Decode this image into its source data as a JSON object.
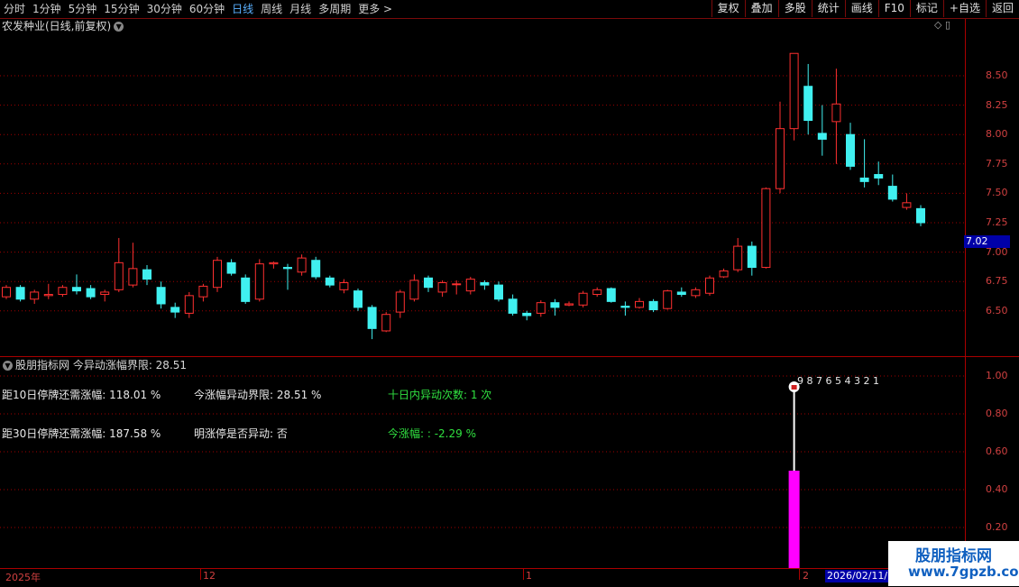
{
  "toolbar": {
    "periods": [
      "分时",
      "1分钟",
      "5分钟",
      "15分钟",
      "30分钟",
      "60分钟",
      "日线",
      "周线",
      "月线",
      "多周期",
      "更多 >"
    ],
    "active_period": "日线",
    "buttons": [
      "复权",
      "叠加",
      "多股",
      "统计",
      "画线",
      "F10",
      "标记",
      "+自选",
      "返回"
    ]
  },
  "chart_title": "农发种业(日线,前复权)",
  "price_axis": [
    "8.50",
    "8.25",
    "8.00",
    "7.75",
    "7.50",
    "7.25",
    "7.00",
    "6.75",
    "6.50"
  ],
  "current_price": "7.02",
  "indicator": {
    "title": "股朋指标网  今异动涨幅界限: 28.51",
    "line1_left": "距10日停牌还需涨幅: 118.01 %",
    "line1_mid": "今涨幅异动界限: 28.51 %",
    "line1_right": "十日内异动次数: 1 次",
    "line2_left": "距30日停牌还需涨幅: 187.58 %",
    "line2_mid": "明涨停是否异动: 否",
    "line2_right": "今涨幅: : -2.29 %",
    "countdown": "9 8 7 6 5 4 3 2 1",
    "axis": [
      "1.00",
      "0.80",
      "0.60",
      "0.40",
      "0.20"
    ]
  },
  "dates": {
    "year": "2025年",
    "m12": "12",
    "m1": "1",
    "m2": "2",
    "cursor": "2026/02/11/"
  },
  "watermark": {
    "line1": "股朋指标网",
    "line2": "www.7gpzb.com"
  },
  "colors": {
    "up": "#ff3030",
    "down": "#40f0f0",
    "magenta": "#ff00ff",
    "grid": "#a00000"
  },
  "chart_data": {
    "type": "candlestick",
    "price_range": [
      6.2,
      9.1
    ],
    "candles": [
      [
        6.62,
        6.7,
        6.72,
        6.6
      ],
      [
        6.7,
        6.6,
        6.72,
        6.58
      ],
      [
        6.6,
        6.66,
        6.68,
        6.56
      ],
      [
        6.63,
        6.64,
        6.73,
        6.6
      ],
      [
        6.64,
        6.7,
        6.72,
        6.62
      ],
      [
        6.7,
        6.67,
        6.81,
        6.64
      ],
      [
        6.69,
        6.62,
        6.72,
        6.6
      ],
      [
        6.64,
        6.66,
        6.68,
        6.58
      ],
      [
        6.68,
        6.91,
        7.12,
        6.66
      ],
      [
        6.72,
        6.86,
        7.08,
        6.7
      ],
      [
        6.85,
        6.77,
        6.89,
        6.72
      ],
      [
        6.7,
        6.56,
        6.75,
        6.52
      ],
      [
        6.53,
        6.49,
        6.57,
        6.44
      ],
      [
        6.48,
        6.63,
        6.66,
        6.44
      ],
      [
        6.62,
        6.71,
        6.73,
        6.58
      ],
      [
        6.7,
        6.93,
        6.96,
        6.66
      ],
      [
        6.91,
        6.82,
        6.94,
        6.8
      ],
      [
        6.78,
        6.58,
        6.81,
        6.56
      ],
      [
        6.6,
        6.9,
        6.94,
        6.58
      ],
      [
        6.9,
        6.91,
        6.92,
        6.86
      ],
      [
        6.87,
        6.86,
        6.9,
        6.68
      ],
      [
        6.83,
        6.95,
        6.98,
        6.8
      ],
      [
        6.93,
        6.79,
        6.96,
        6.77
      ],
      [
        6.78,
        6.72,
        6.8,
        6.7
      ],
      [
        6.68,
        6.74,
        6.77,
        6.65
      ],
      [
        6.67,
        6.53,
        6.69,
        6.5
      ],
      [
        6.53,
        6.35,
        6.55,
        6.26
      ],
      [
        6.33,
        6.47,
        6.49,
        6.32
      ],
      [
        6.49,
        6.66,
        6.68,
        6.44
      ],
      [
        6.6,
        6.76,
        6.81,
        6.58
      ],
      [
        6.78,
        6.7,
        6.8,
        6.66
      ],
      [
        6.66,
        6.74,
        6.76,
        6.62
      ],
      [
        6.73,
        6.73,
        6.76,
        6.64
      ],
      [
        6.67,
        6.77,
        6.79,
        6.64
      ],
      [
        6.74,
        6.72,
        6.76,
        6.68
      ],
      [
        6.72,
        6.6,
        6.75,
        6.58
      ],
      [
        6.6,
        6.48,
        6.64,
        6.46
      ],
      [
        6.48,
        6.46,
        6.5,
        6.42
      ],
      [
        6.48,
        6.57,
        6.59,
        6.45
      ],
      [
        6.57,
        6.53,
        6.6,
        6.46
      ],
      [
        6.55,
        6.56,
        6.58,
        6.54
      ],
      [
        6.55,
        6.65,
        6.67,
        6.53
      ],
      [
        6.64,
        6.68,
        6.7,
        6.62
      ],
      [
        6.69,
        6.58,
        6.7,
        6.57
      ],
      [
        6.54,
        6.53,
        6.58,
        6.46
      ],
      [
        6.53,
        6.58,
        6.61,
        6.52
      ],
      [
        6.58,
        6.51,
        6.6,
        6.49
      ],
      [
        6.52,
        6.67,
        6.68,
        6.51
      ],
      [
        6.66,
        6.64,
        6.7,
        6.62
      ],
      [
        6.63,
        6.68,
        6.7,
        6.61
      ],
      [
        6.65,
        6.78,
        6.8,
        6.63
      ],
      [
        6.79,
        6.84,
        6.86,
        6.78
      ],
      [
        6.85,
        7.05,
        7.12,
        6.83
      ],
      [
        7.05,
        6.87,
        7.09,
        6.8
      ],
      [
        6.87,
        7.54,
        7.55,
        6.86
      ],
      [
        7.54,
        8.05,
        8.28,
        7.5
      ],
      [
        8.05,
        8.69,
        8.69,
        7.95
      ],
      [
        8.41,
        8.12,
        8.6,
        8.0
      ],
      [
        8.01,
        7.96,
        8.25,
        7.82
      ],
      [
        8.11,
        8.26,
        8.56,
        7.75
      ],
      [
        8.0,
        7.73,
        8.1,
        7.7
      ],
      [
        7.63,
        7.6,
        7.96,
        7.55
      ],
      [
        7.66,
        7.63,
        7.77,
        7.57
      ],
      [
        7.56,
        7.45,
        7.66,
        7.43
      ],
      [
        7.38,
        7.42,
        7.5,
        7.36
      ],
      [
        7.37,
        7.25,
        7.4,
        7.22
      ]
    ]
  }
}
